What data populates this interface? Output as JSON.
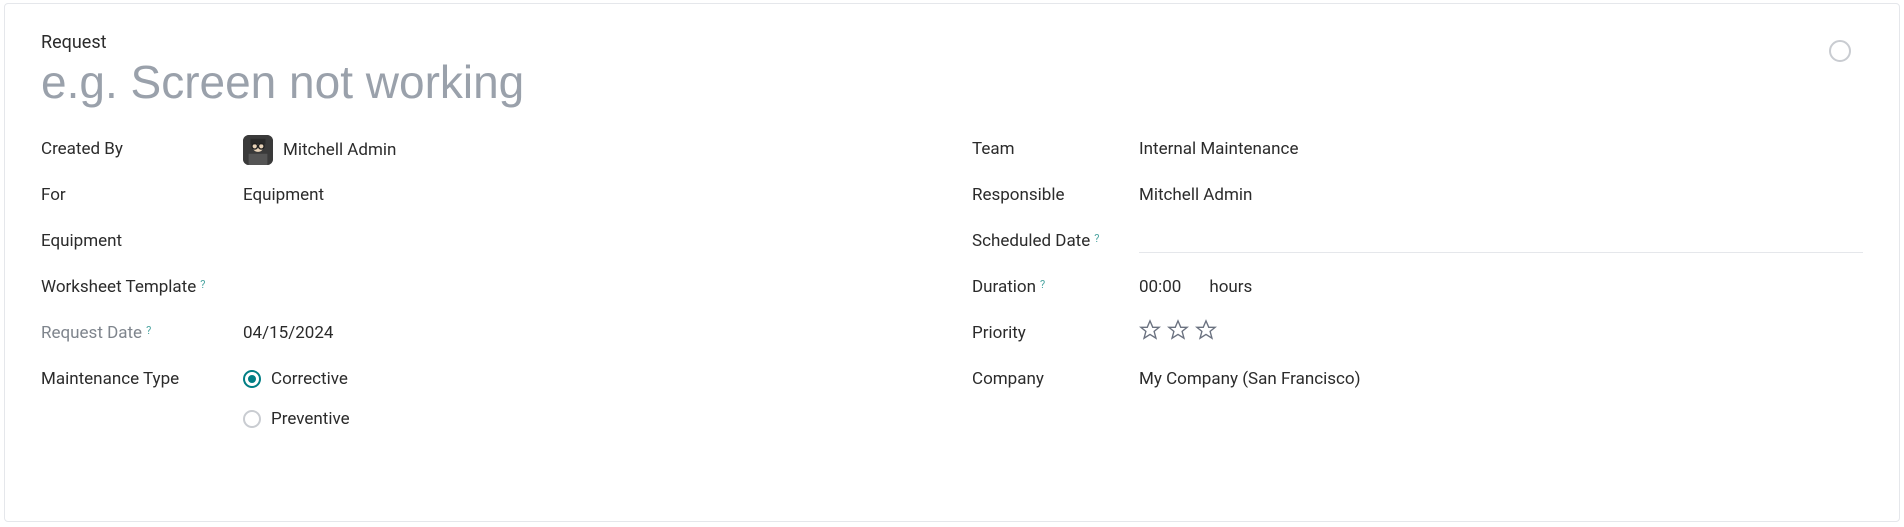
{
  "header": {
    "label": "Request",
    "title_placeholder": "e.g. Screen not working",
    "title_value": ""
  },
  "left": {
    "created_by_label": "Created By",
    "created_by_value": "Mitchell Admin",
    "for_label": "For",
    "for_value": "Equipment",
    "equipment_label": "Equipment",
    "equipment_value": "",
    "worksheet_template_label": "Worksheet Template",
    "worksheet_template_value": "",
    "request_date_label": "Request Date",
    "request_date_value": "04/15/2024",
    "maintenance_type_label": "Maintenance Type",
    "maintenance_type_options": {
      "corrective": "Corrective",
      "preventive": "Preventive"
    },
    "maintenance_type_selected": "corrective"
  },
  "right": {
    "team_label": "Team",
    "team_value": "Internal Maintenance",
    "responsible_label": "Responsible",
    "responsible_value": "Mitchell Admin",
    "scheduled_date_label": "Scheduled Date",
    "scheduled_date_value": "",
    "duration_label": "Duration",
    "duration_value": "00:00",
    "duration_unit": "hours",
    "priority_label": "Priority",
    "priority_stars": 3,
    "priority_value": 0,
    "company_label": "Company",
    "company_value": "My Company (San Francisco)"
  },
  "help_marker": "?"
}
